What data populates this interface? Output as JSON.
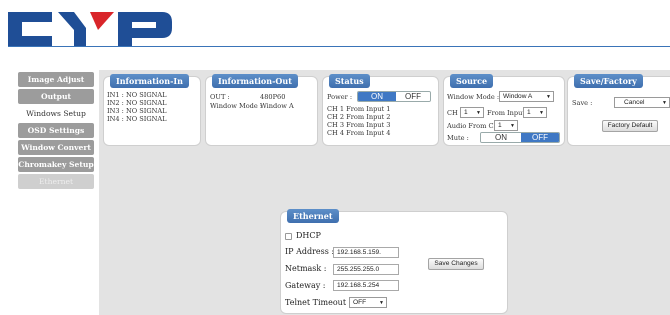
{
  "logo": {
    "text": "CYP",
    "colors": {
      "primary": "#1f4e96",
      "accent": "#d9252a"
    }
  },
  "menu": {
    "items": [
      {
        "label": "Image Adjust",
        "state": "normal"
      },
      {
        "label": "Output Resolution",
        "state": "normal"
      },
      {
        "label": "Windows Setup",
        "state": "active"
      },
      {
        "label": "OSD Settings",
        "state": "normal"
      },
      {
        "label": "Window Convert",
        "state": "normal"
      },
      {
        "label": "Chromakey Setup",
        "state": "normal"
      },
      {
        "label": "Ethernet",
        "state": "disabled"
      }
    ]
  },
  "info_in": {
    "title": "Information-In",
    "lines": [
      "IN1 : NO SIGNAL",
      "IN2 : NO SIGNAL",
      "IN3 : NO SIGNAL",
      "IN4 : NO SIGNAL"
    ]
  },
  "info_out": {
    "title": "Information-Out",
    "out_label": "OUT :",
    "out_value": "480P60",
    "window_mode_label": "Window Mode :",
    "window_mode_value": "Window A"
  },
  "status": {
    "title": "Status",
    "power_label": "Power :",
    "on_label": "ON",
    "off_label": "OFF",
    "power_state": "ON",
    "channels": [
      "CH 1 From Input   1",
      "CH 2 From Input   2",
      "CH 3 From Input   3",
      "CH 4 From Input   4"
    ]
  },
  "source": {
    "title": "Source",
    "window_mode_label": "Window Mode :",
    "window_mode_value": "Window A",
    "ch_label": "CH",
    "ch_value": "1",
    "from_input_label": "From Input",
    "from_input_value": "1",
    "audio_label": "Audio From CH",
    "audio_value": "1",
    "mute_label": "Mute :",
    "on_label": "ON",
    "off_label": "OFF",
    "mute_state": "OFF"
  },
  "save_factory": {
    "title": "Save/Factory",
    "save_label": "Save :",
    "save_value": "Cancel",
    "factory_button": "Factory Default"
  },
  "ethernet": {
    "title": "Ethernet",
    "dhcp_label": "DHCP",
    "dhcp_checked": false,
    "ip_label": "IP Address :",
    "ip_value": "192.168.5.159.",
    "netmask_label": "Netmask :",
    "netmask_value": "255.255.255.0",
    "gateway_label": "Gateway :",
    "gateway_value": "192.168.5.254",
    "telnet_label": "Telnet Timeout :",
    "telnet_value": "OFF",
    "save_button": "Save Changes"
  },
  "icons": {
    "dropdown": "chevron-down-icon"
  }
}
